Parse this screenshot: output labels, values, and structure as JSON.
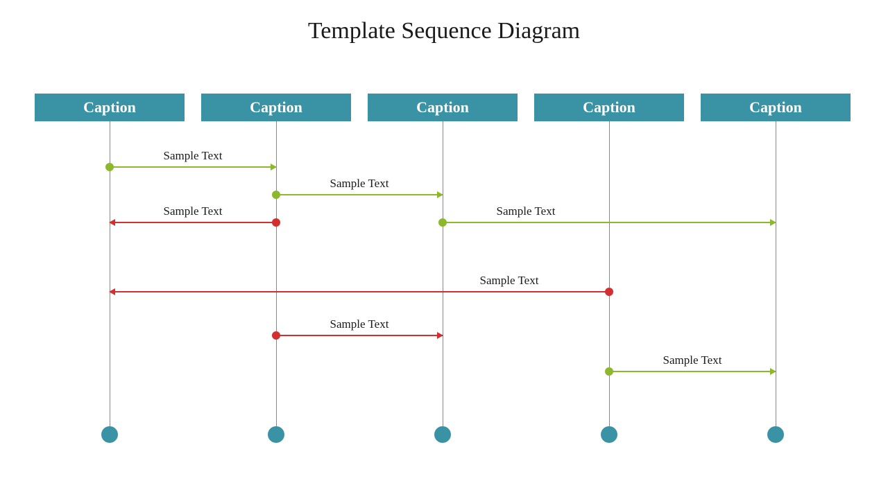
{
  "title": "Template Sequence Diagram",
  "colors": {
    "header": "#3a92a5",
    "green": "#8cb82c",
    "red": "#d32f2f"
  },
  "lanes": [
    {
      "label": "Caption"
    },
    {
      "label": "Caption"
    },
    {
      "label": "Caption"
    },
    {
      "label": "Caption"
    },
    {
      "label": "Caption"
    }
  ],
  "messages": [
    {
      "label": "Sample Text",
      "from": 0,
      "to": 1,
      "color": "green",
      "dir": "right"
    },
    {
      "label": "Sample Text",
      "from": 1,
      "to": 2,
      "color": "green",
      "dir": "right"
    },
    {
      "label": "Sample Text",
      "from": 1,
      "to": 0,
      "color": "red",
      "dir": "left"
    },
    {
      "label": "Sample Text",
      "from": 2,
      "to": 4,
      "color": "green",
      "dir": "right"
    },
    {
      "label": "Sample Text",
      "from": 3,
      "to": 0,
      "color": "red",
      "dir": "left"
    },
    {
      "label": "Sample Text",
      "from": 1,
      "to": 2,
      "color": "red",
      "dir": "right"
    },
    {
      "label": "Sample Text",
      "from": 3,
      "to": 4,
      "color": "green",
      "dir": "right"
    }
  ]
}
